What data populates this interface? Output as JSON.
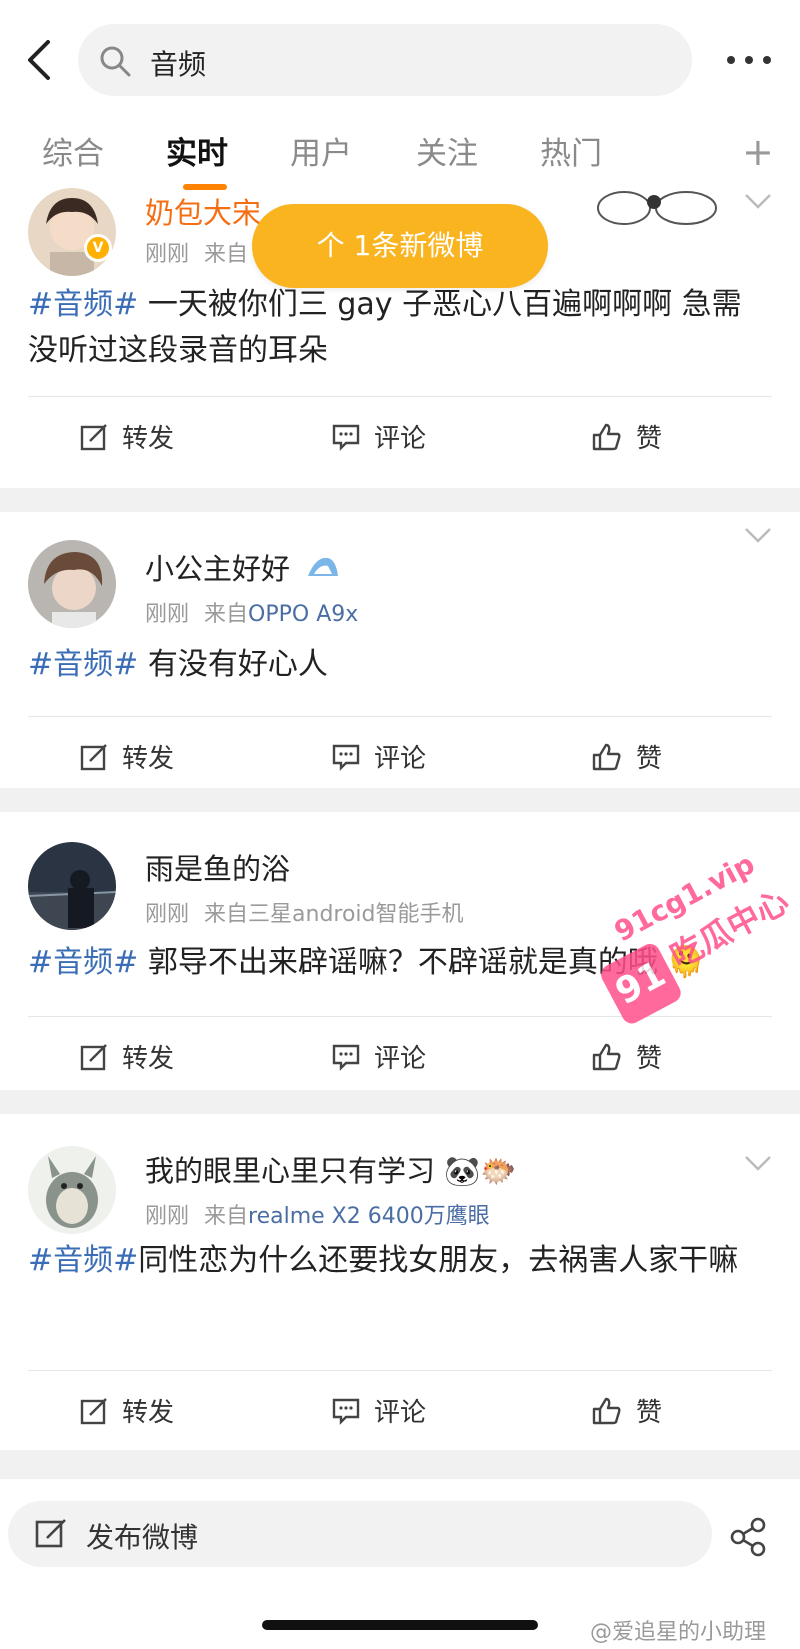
{
  "search": {
    "query": "音频"
  },
  "tabs": [
    {
      "label": "综合"
    },
    {
      "label": "实时"
    },
    {
      "label": "用户"
    },
    {
      "label": "关注"
    },
    {
      "label": "热门"
    }
  ],
  "new_posts_bubble": "个 1条新微博",
  "posts": [
    {
      "user": "奶包大宋",
      "time": "刚刚",
      "source": "来自",
      "tag": "#音频#",
      "text": " 一天被你们三 gay 子恶心八百遍啊啊啊 急需没听过这段录音的耳朵",
      "verified": true
    },
    {
      "user": "小公主好好",
      "time": "刚刚",
      "source_prefix": "来自",
      "source": "OPPO A9x",
      "tag": "#音频#",
      "text": " 有没有好心人"
    },
    {
      "user": "雨是鱼的浴",
      "time": "刚刚",
      "source": "来自三星android智能手机",
      "tag": "#音频#",
      "text": " 郭导不出来辟谣嘛？不辟谣就是真的哦 🫠"
    },
    {
      "user": "我的眼里心里只有学习 🐼🐡",
      "time": "刚刚",
      "source_prefix": "来自",
      "source": "realme X2 6400万鹰眼",
      "tag": "#音频#",
      "text": "同性恋为什么还要找女朋友，去祸害人家干嘛"
    }
  ],
  "actions": {
    "repost": "转发",
    "comment": "评论",
    "like": "赞"
  },
  "compose": {
    "label": "发布微博"
  },
  "watermark": {
    "url": "91cg1.vip",
    "name": "吃瓜中心",
    "logo": "91"
  },
  "credit": "@爱追星的小助理",
  "colors": {
    "accent": "#ff8200",
    "bubble": "#f9b420",
    "tag": "#3a6db5",
    "source": "#4a6ea3"
  }
}
